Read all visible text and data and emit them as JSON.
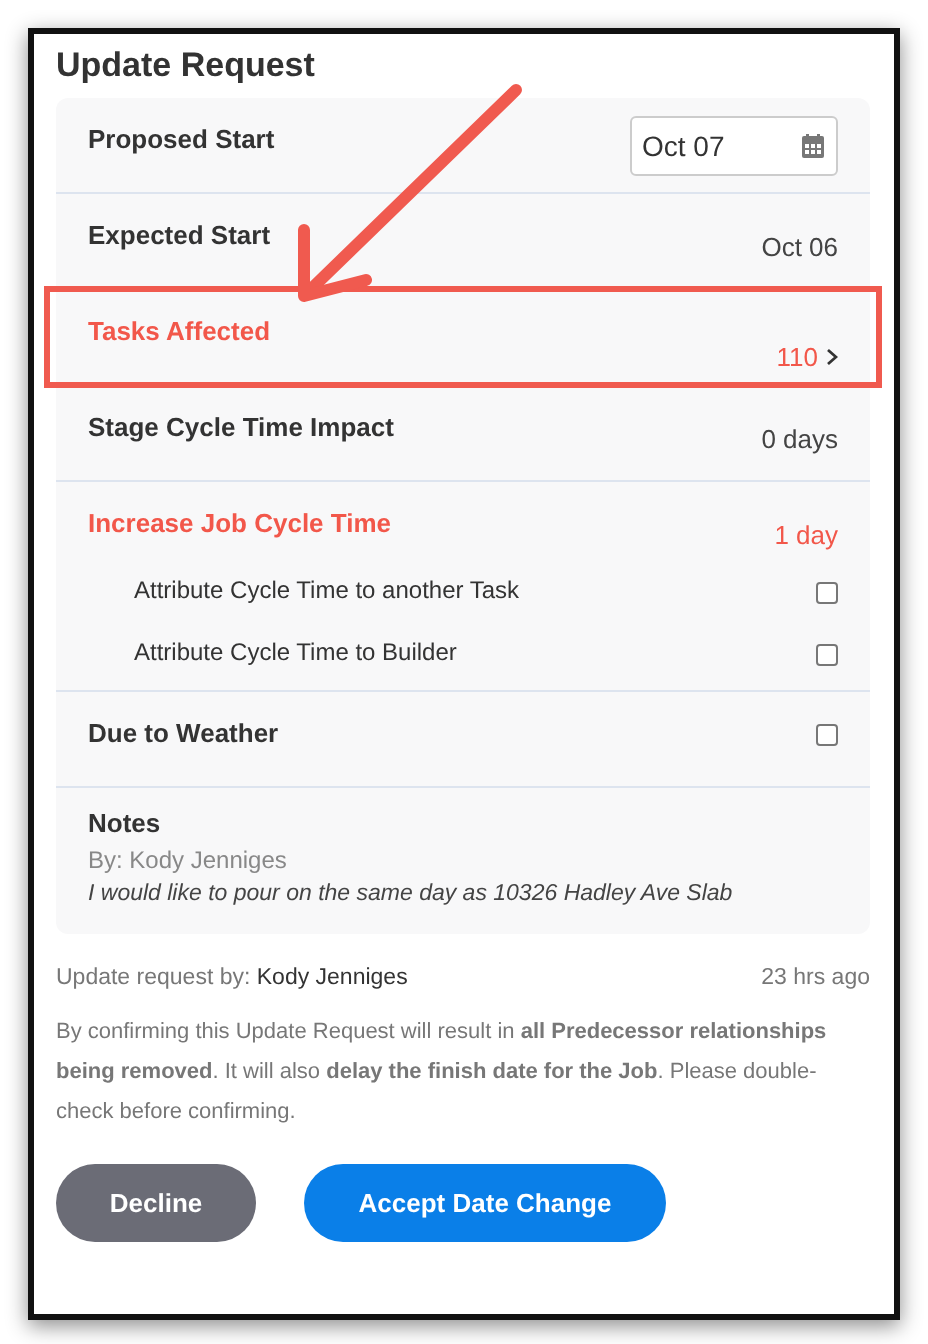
{
  "title": "Update Request",
  "rows": [
    {
      "kind": "date",
      "label": "Proposed Start",
      "value": "Oct 07",
      "highlighted": false
    },
    {
      "kind": "text",
      "label": "Expected Start",
      "value": "Oct 06",
      "highlighted": false
    },
    {
      "kind": "link",
      "label": "Tasks Affected",
      "value": "110",
      "alert": true,
      "highlighted": true
    },
    {
      "kind": "text",
      "label": "Stage Cycle Time Impact",
      "value": "0 days",
      "highlighted": false
    },
    {
      "kind": "group",
      "label": "Increase Job Cycle Time",
      "value": "1 day",
      "alert": true,
      "highlighted": false,
      "options": [
        {
          "label": "Attribute Cycle Time to another Task",
          "checked": false
        },
        {
          "label": "Attribute Cycle Time to Builder",
          "checked": false
        }
      ]
    },
    {
      "kind": "check",
      "label": "Due to Weather",
      "checked": false,
      "highlighted": false
    }
  ],
  "notes": {
    "heading": "Notes",
    "author": "By: Kody Jenniges",
    "text": "I would like to pour on the same day as 10326 Hadley Ave Slab"
  },
  "requested_by": {
    "label": "Update request by:",
    "name": "Kody Jenniges",
    "time": "23 hrs ago"
  },
  "warning": "By confirming this Update Request will result in **all Predecessor relationships being removed**. It will also **delay the finish date for the Job**. Please double-check before confirming.",
  "buttons": [
    {
      "label": "Decline",
      "kind": "secondary"
    },
    {
      "label": "Accept Date Change",
      "kind": "primary"
    }
  ]
}
